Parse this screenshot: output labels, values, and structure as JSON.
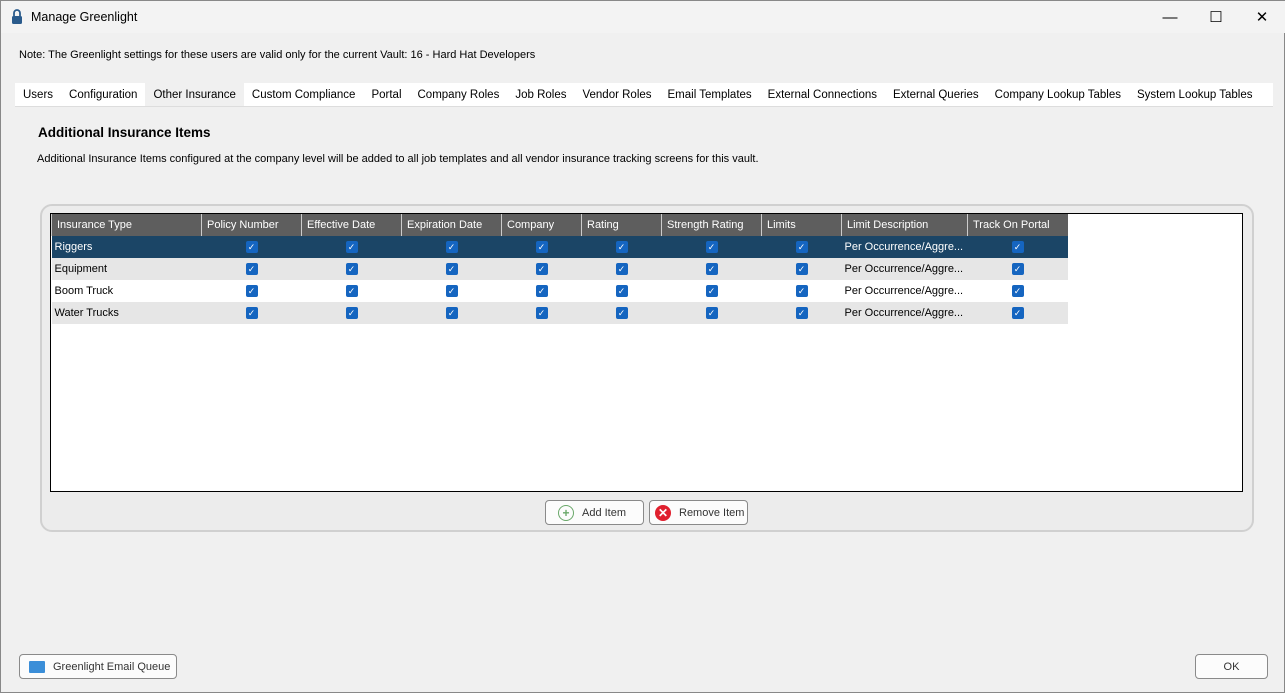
{
  "window": {
    "title": "Manage Greenlight",
    "icon": "lock-icon"
  },
  "note": "Note:  The Greenlight settings for these users are valid only for the current Vault: 16 - Hard Hat Developers",
  "tabs": [
    "Users",
    "Configuration",
    "Other Insurance",
    "Custom Compliance",
    "Portal",
    "Company Roles",
    "Job Roles",
    "Vendor Roles",
    "Email Templates",
    "External Connections",
    "External Queries",
    "Company Lookup Tables",
    "System Lookup Tables"
  ],
  "active_tab": "Other Insurance",
  "section": {
    "title": "Additional Insurance Items",
    "description": "Additional Insurance Items configured at the company level will be added to all job templates and all vendor insurance tracking screens for this vault."
  },
  "grid": {
    "columns": [
      "Insurance Type",
      "Policy Number",
      "Effective Date",
      "Expiration Date",
      "Company",
      "Rating",
      "Strength Rating",
      "Limits",
      "Limit Description",
      "Track On Portal"
    ],
    "rows": [
      {
        "type": "Riggers",
        "checks": [
          true,
          true,
          true,
          true,
          true,
          true,
          true
        ],
        "limit_description": "Per Occurrence/Aggre...",
        "track": true,
        "selected": true
      },
      {
        "type": "Equipment",
        "checks": [
          true,
          true,
          true,
          true,
          true,
          true,
          true
        ],
        "limit_description": "Per Occurrence/Aggre...",
        "track": true
      },
      {
        "type": "Boom Truck",
        "checks": [
          true,
          true,
          true,
          true,
          true,
          true,
          true
        ],
        "limit_description": "Per Occurrence/Aggre...",
        "track": true
      },
      {
        "type": "Water Trucks",
        "checks": [
          true,
          true,
          true,
          true,
          true,
          true,
          true
        ],
        "limit_description": "Per Occurrence/Aggre...",
        "track": true
      }
    ]
  },
  "buttons": {
    "add": "Add Item",
    "remove": "Remove Item",
    "email_queue": "Greenlight Email Queue",
    "ok": "OK"
  },
  "colors": {
    "selected_row": "#1b4566",
    "header": "#5e5e5e",
    "checkbox": "#1565c0"
  }
}
